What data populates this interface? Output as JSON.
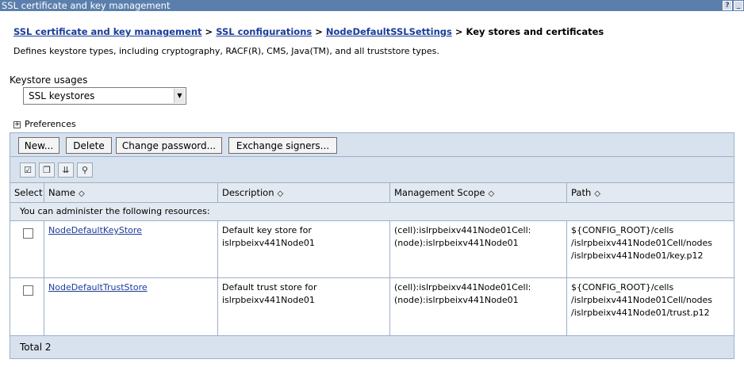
{
  "window": {
    "title": "SSL certificate and key management",
    "help_glyph": "?",
    "minimize_glyph": "_"
  },
  "breadcrumb": {
    "items": [
      "SSL certificate and key management",
      "SSL configurations",
      "NodeDefaultSSLSettings"
    ],
    "separator": ">",
    "current": "Key stores and certificates"
  },
  "description": "Defines keystore types, including cryptography, RACF(R), CMS, Java(TM), and all truststore types.",
  "keystore_usages": {
    "label": "Keystore usages",
    "selected": "SSL keystores"
  },
  "preferences": {
    "label": "Preferences",
    "expand_glyph": "+"
  },
  "toolbar": {
    "buttons": [
      "New...",
      "Delete",
      "Change password...",
      "Exchange signers..."
    ]
  },
  "icon_toolbar": [
    "select-all-icon",
    "deselect-all-icon",
    "show-filter-icon",
    "clear-filter-icon"
  ],
  "table": {
    "columns": [
      "Select",
      "Name",
      "Description",
      "Management Scope",
      "Path"
    ],
    "sort_glyph": "◇",
    "admin_message": "You can administer the following resources:",
    "rows": [
      {
        "name": "NodeDefaultKeyStore",
        "description": [
          "Default key store for",
          "islrpbeixv441Node01"
        ],
        "scope": [
          "(cell):islrpbeixv441Node01Cell:",
          "(node):islrpbeixv441Node01"
        ],
        "path": [
          "${CONFIG_ROOT}/cells",
          "/islrpbeixv441Node01Cell/nodes",
          "/islrpbeixv441Node01/key.p12"
        ]
      },
      {
        "name": "NodeDefaultTrustStore",
        "description": [
          "Default trust store for",
          "islrpbeixv441Node01"
        ],
        "scope": [
          "(cell):islrpbeixv441Node01Cell:",
          "(node):islrpbeixv441Node01"
        ],
        "path": [
          "${CONFIG_ROOT}/cells",
          "/islrpbeixv441Node01Cell/nodes",
          "/islrpbeixv441Node01/trust.p12"
        ]
      }
    ],
    "total": "Total 2"
  }
}
